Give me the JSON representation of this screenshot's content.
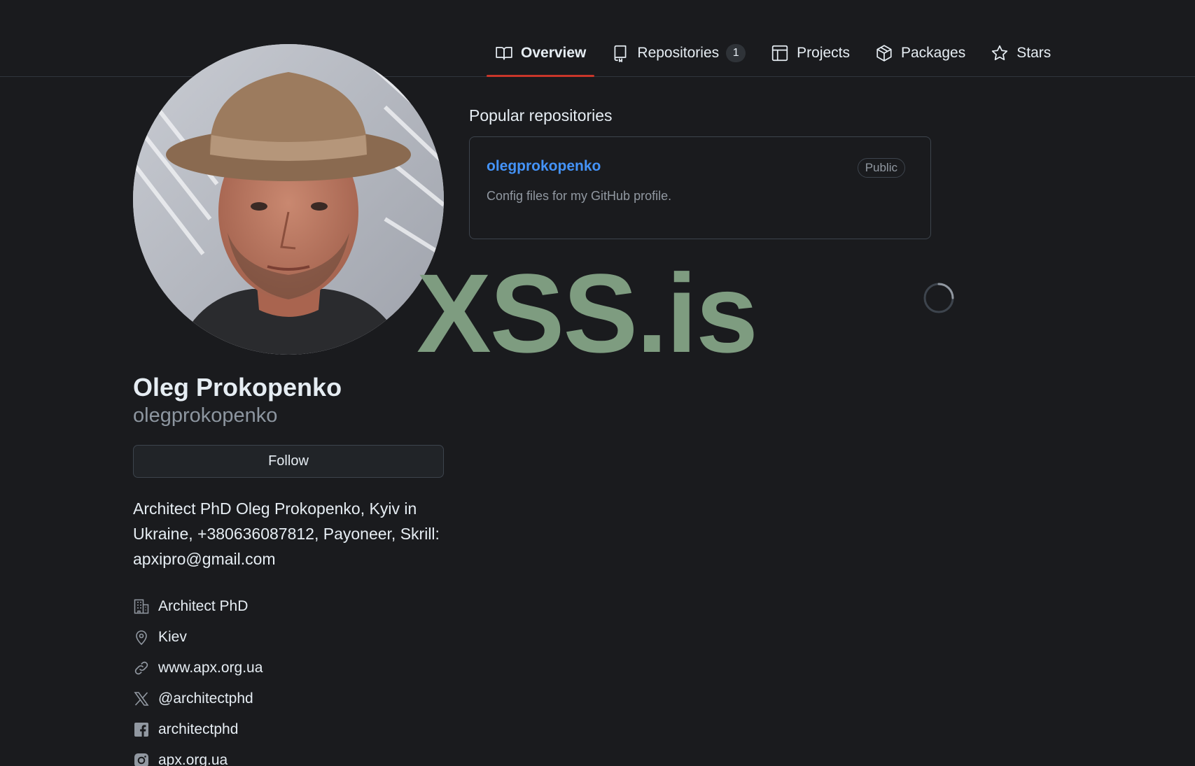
{
  "nav": {
    "tabs": [
      {
        "label": "Overview",
        "icon": "book-icon"
      },
      {
        "label": "Repositories",
        "icon": "repo-icon",
        "count": "1"
      },
      {
        "label": "Projects",
        "icon": "table-icon"
      },
      {
        "label": "Packages",
        "icon": "package-icon"
      },
      {
        "label": "Stars",
        "icon": "star-icon"
      }
    ],
    "active_tab": "Overview",
    "accent_color": "#c9362a"
  },
  "profile": {
    "full_name": "Oleg Prokopenko",
    "username": "olegprokopenko",
    "follow_label": "Follow",
    "bio": "Architect PhD Oleg Prokopenko, Kyiv in Ukraine, +380636087812, Payoneer, Skrill: apxipro@gmail.com",
    "details": [
      {
        "icon": "organization-icon",
        "text": "Architect PhD"
      },
      {
        "icon": "location-icon",
        "text": "Kiev"
      },
      {
        "icon": "link-icon",
        "text": "www.apx.org.ua"
      },
      {
        "icon": "x-logo-icon",
        "text": "@architectphd"
      },
      {
        "icon": "facebook-icon",
        "text": "architectphd"
      },
      {
        "icon": "instagram-icon",
        "text": "apx.org.ua"
      }
    ]
  },
  "popular": {
    "title": "Popular repositories",
    "repos": [
      {
        "name": "olegprokopenko",
        "visibility": "Public",
        "description": "Config files for my GitHub profile."
      }
    ]
  },
  "watermark": {
    "text": "XSS.is",
    "color": "#7e9c80"
  },
  "colors": {
    "background": "#1a1b1e",
    "link": "#4493f8",
    "muted": "#9198a1"
  }
}
